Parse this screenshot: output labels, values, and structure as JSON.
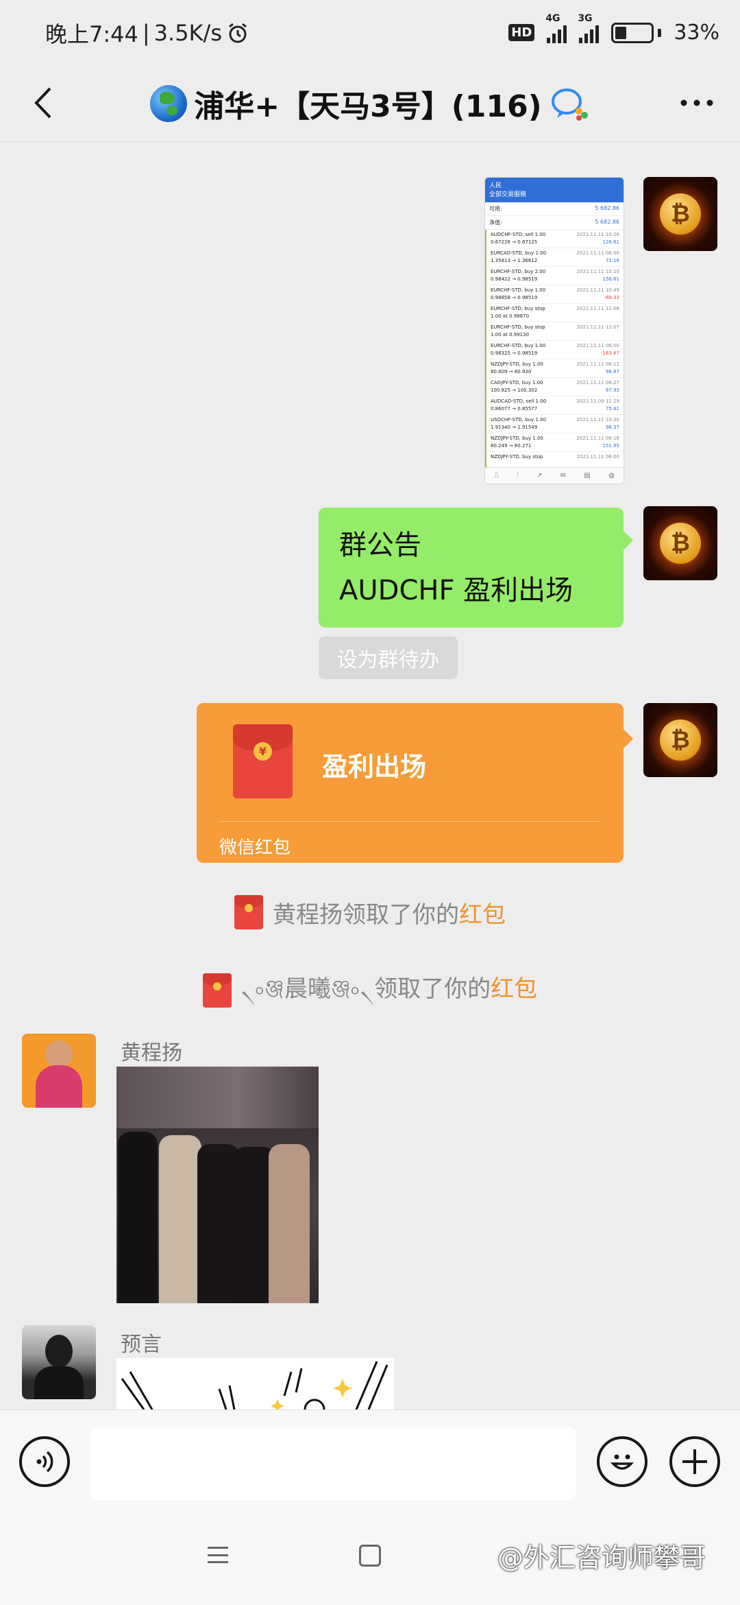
{
  "status_bar": {
    "time": "晚上7:44",
    "net_speed": "3.5K/s",
    "hd": "HD",
    "signal_1": "4G",
    "signal_2": "3G",
    "battery": "33%"
  },
  "header": {
    "title": "浦华+【天马3号】(116)"
  },
  "screenshot_msg": {
    "header_line1": "人民",
    "header_line2": "全部交易服務",
    "balance_label": "可用:",
    "balance_value": "5 682.86",
    "equity_label": "净值:",
    "equity_value": "5 682.86",
    "rows": [
      {
        "pair": "AUDCHF-STD, sell 1.00",
        "sub": "0.67226 → 0.67125",
        "date": "2021.11.11 10:26",
        "pl": "126.61"
      },
      {
        "pair": "EURCAD-STD, buy 1.00",
        "sub": "1.35813 → 1.36612",
        "date": "2021.11.11 06:00",
        "pl": "71.16"
      },
      {
        "pair": "EURCHF-STD, buy 2.00",
        "sub": "0.98422 → 0.98519",
        "date": "2021.11.11 10:10",
        "pl": "156.61"
      },
      {
        "pair": "EURCHF-STD, buy 1.00",
        "sub": "0.98858 → 0.98519",
        "date": "2021.11.11 10:49",
        "pl": "-69.33"
      },
      {
        "pair": "EURCHF-STD, buy stop",
        "sub": "1.00 at 0.98870",
        "date": "2021.11.11 12:06",
        "pl": ""
      },
      {
        "pair": "EURCHF-STD, buy stop",
        "sub": "1.00 at 0.99130",
        "date": "2021.11.11 12:07",
        "pl": ""
      },
      {
        "pair": "EURCHF-STD, buy 1.00",
        "sub": "0.98325 → 0.98519",
        "date": "2021.11.11 06:00",
        "pl": "-163.67"
      },
      {
        "pair": "NZDJPY-STD, buy 1.00",
        "sub": "80.809 → 80.930",
        "date": "2021.11.11 06:12",
        "pl": "98.87"
      },
      {
        "pair": "CADJPY-STD, buy 1.00",
        "sub": "100.825 → 100.302",
        "date": "2021.11.11 06:27",
        "pl": "67.93"
      },
      {
        "pair": "AUDCAD-STD, sell 1.00",
        "sub": "0.86077 → 0.85577",
        "date": "2021.11.09 11:29",
        "pl": "75.41"
      },
      {
        "pair": "USDCHF-STD, buy 1.00",
        "sub": "1.91340 → 1.91549",
        "date": "2021.11.11 10:30",
        "pl": "98.37"
      },
      {
        "pair": "NZDJPY-STD, buy 1.00",
        "sub": "80.249 → 80.271",
        "date": "2021.11.11 08:18",
        "pl": "151.95"
      },
      {
        "pair": "NZDJPY-STD, buy stop",
        "sub": "",
        "date": "2021.11.11 06:00",
        "pl": ""
      }
    ]
  },
  "announcement": {
    "line1": "群公告",
    "line2": "AUDCHF 盈利出场",
    "todo_label": "设为群待办"
  },
  "red_packet": {
    "title": "盈利出场",
    "footer": "微信红包"
  },
  "system_msgs": [
    {
      "prefix": "黄程扬领取了你的",
      "highlight": "红包"
    },
    {
      "prefix": "৲৹ঞ্জ晨曦ঞ্জ৹৲领取了你的",
      "highlight": "红包"
    }
  ],
  "messages": [
    {
      "sender": "黄程扬"
    },
    {
      "sender": "预言"
    }
  ],
  "input_bar": {
    "placeholder": ""
  },
  "watermark": "@外汇咨询师攀哥",
  "colors": {
    "background": "#ededed",
    "self_bubble": "#95ec69",
    "red_packet": "#f79c39",
    "highlight": "#f0932d"
  }
}
